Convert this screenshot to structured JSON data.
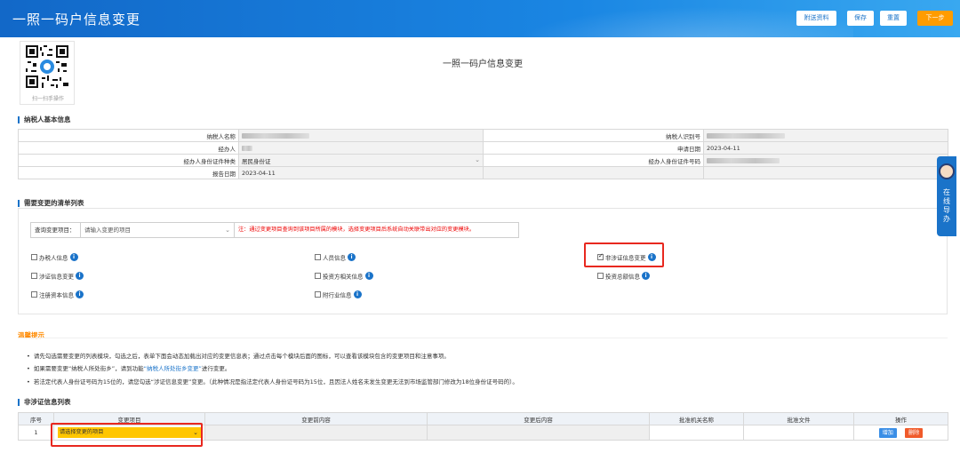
{
  "header": {
    "title": "一照一码户信息变更",
    "buttons": [
      "附送资料",
      "保存",
      "重置",
      "下一步"
    ]
  },
  "qr": {
    "caption": "扫一扫手操作"
  },
  "page_title": "一照一码户信息变更",
  "basic_section": {
    "title": "纳税人基本信息",
    "rows": [
      {
        "l1": "纳税人名称",
        "v1": "",
        "l2": "纳税人识别号",
        "v2": ""
      },
      {
        "l1": "经办人",
        "v1": "",
        "l2": "申请日期",
        "v2": "2023-04-11"
      },
      {
        "l1": "经办人身份证件种类",
        "v1": "居民身份证",
        "l2": "经办人身份证件号码",
        "v2": ""
      },
      {
        "l1": "报告日期",
        "v1": "2023-04-11",
        "l2": "",
        "v2": ""
      }
    ]
  },
  "change_section": {
    "title": "需要变更的清单列表",
    "query_label": "查询变更项目：",
    "query_placeholder": "请输入变更的项目",
    "note": "注：通过变更项目查询到该项目所属的模块，选择变更项目后系统自动关联带出对应的变更模块。",
    "checkboxes": [
      {
        "label": "办税人信息",
        "checked": false
      },
      {
        "label": "人员信息",
        "checked": false
      },
      {
        "label": "非涉证信息变更",
        "checked": true
      },
      {
        "label": "涉证信息变更",
        "checked": false
      },
      {
        "label": "投资方相关信息",
        "checked": false
      },
      {
        "label": "投资总额信息",
        "checked": false
      },
      {
        "label": "注册资本信息",
        "checked": false
      },
      {
        "label": "附行业信息",
        "checked": false
      }
    ]
  },
  "tips": {
    "title": "温馨提示",
    "items": [
      "请先勾选需要变更的列表模块，勾选之后，表单下面会动态加载出对应的变更信息表；通过点击每个模块后面的图标，可以查看该模块包含的变更项目和注意事项。",
      "如果需要变更“纳税人所处街乡”，请到功能",
      "“纳税人所处街乡变更”",
      "进行变更。",
      "若法定代表人身份证号码为15位的，请您勾选“涉证信息变更”变更。（此种情况是指法定代表人身份证号码为15位，且因法人姓名未发生变更无法到市场监管部门修改为18位身份证号码的）。"
    ]
  },
  "list_section": {
    "title": "非涉证信息列表",
    "headers": [
      "序号",
      "变更项目",
      "变更前内容",
      "变更后内容",
      "批准机关名称",
      "批准文件",
      "操作"
    ],
    "row": {
      "index": "1",
      "select_placeholder": "请选择变更的项目",
      "add": "增加",
      "delete": "删除"
    }
  },
  "assistant": {
    "text": "在线导办"
  }
}
